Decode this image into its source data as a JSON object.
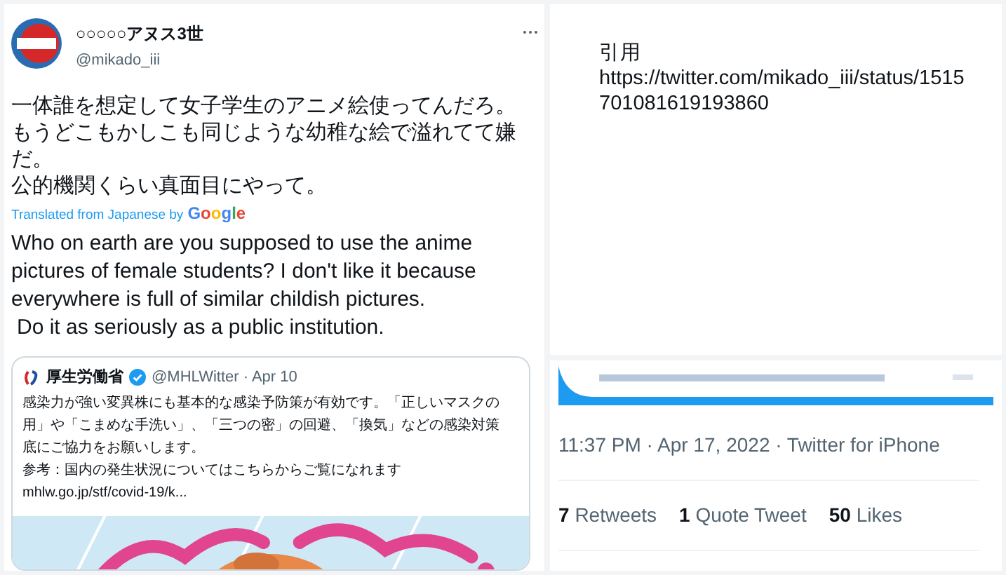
{
  "tweet": {
    "display_name": "○○○○○アヌス3世",
    "handle": "@mikado_iii",
    "text_lines": [
      "一体誰を想定して女子学生のアニメ絵使ってんだろ。",
      "もうどこもかしこも同じような幼稚な絵で溢れてて嫌だ。",
      "公的機関くらい真面目にやって。"
    ],
    "translated_label": "Translated from Japanese by",
    "translator": "Google",
    "translation_lines": [
      "Who on earth are you supposed to use the anime pictures of female students? I don't like it because everywhere is full of similar childish pictures.",
      "Do it as seriously as a public institution."
    ],
    "quoted": {
      "name": "厚生労働省",
      "verified": true,
      "handle_date": "@MHLWitter · Apr 10",
      "lines": [
        "感染力が強い変異株にも基本的な感染予防策が有効です。「正しいマスクの",
        "用」や「こまめな手洗い」、「三つの密」の回避、「換気」などの感染対策",
        "底にご協力をお願いします。",
        "参考：国内の発生状況についてはこちらからご覧になれます",
        "mhlw.go.jp/stf/covid-19/k..."
      ]
    }
  },
  "note": {
    "title": "引用",
    "url": "https://twitter.com/mikado_iii/status/1515701081619193860"
  },
  "tweet_footer": {
    "timestamp": "11:37 PM · Apr 17, 2022 · Twitter for iPhone",
    "stats": [
      {
        "count": "7",
        "label": "Retweets"
      },
      {
        "count": "1",
        "label": "Quote Tweet"
      },
      {
        "count": "50",
        "label": "Likes"
      }
    ]
  }
}
